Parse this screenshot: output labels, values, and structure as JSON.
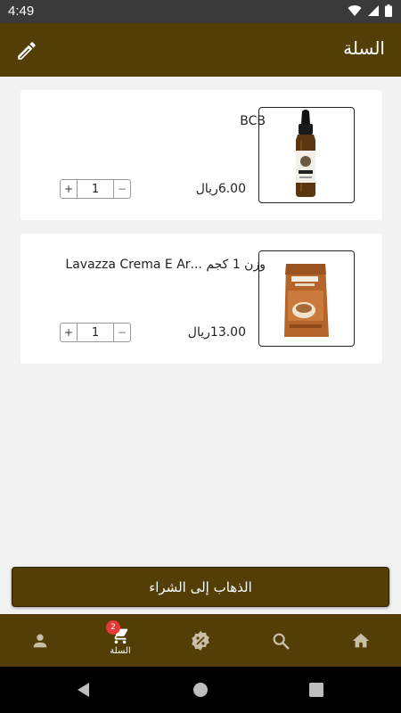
{
  "status_bar": {
    "time": "4:49"
  },
  "header": {
    "title": "السلة"
  },
  "cart": {
    "items": [
      {
        "name": "BCB",
        "price": "6.00ريال",
        "qty": "1",
        "plus": "+",
        "minus": "−"
      },
      {
        "name": "وزن 1 كجم ...Lavazza Crema E Ar",
        "price": "13.00ريال",
        "qty": "1",
        "plus": "+",
        "minus": "−"
      }
    ]
  },
  "checkout": {
    "label": "الذهاب إلى الشراء"
  },
  "bottom_nav": {
    "items": [
      {
        "icon": "person-icon",
        "label": ""
      },
      {
        "icon": "cart-icon",
        "label": "السلة",
        "badge": "2",
        "active": true
      },
      {
        "icon": "discount-icon",
        "label": ""
      },
      {
        "icon": "search-icon",
        "label": ""
      },
      {
        "icon": "home-icon",
        "label": ""
      }
    ]
  },
  "colors": {
    "brand": "#543e07",
    "badge": "#e53935",
    "background": "#f2f2f2"
  }
}
